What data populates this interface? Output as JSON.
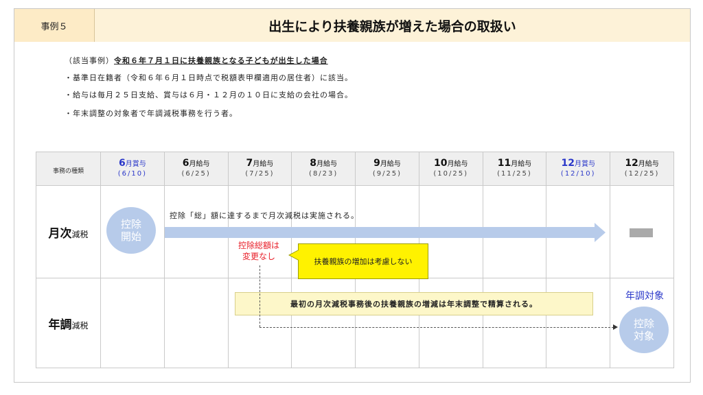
{
  "header": {
    "case_label": "事例５",
    "title": "出生により扶養親族が増えた場合の取扱い"
  },
  "description": {
    "applicable_prefix": "（該当事例）",
    "applicable_case": "令和６年７月１日に扶養親族となる子どもが出生した場合",
    "lines": [
      "・基準日在籍者（令和６年６月１日時点で税額表甲欄適用の居住者）に該当。",
      "・給与は毎月２５日支給、賞与は６月・１２月の１０日に支給の会社の場合。",
      "・年末調整の対象者で年調減税事務を行う者。"
    ]
  },
  "table": {
    "kind_header": "事務の種類",
    "months": [
      {
        "num": "6",
        "type": "月賞与",
        "date": "(6/10)",
        "accent": "#2a37c9"
      },
      {
        "num": "6",
        "type": "月給与",
        "date": "(6/25)",
        "accent": "#111111"
      },
      {
        "num": "7",
        "type": "月給与",
        "date": "(7/25)",
        "accent": "#111111"
      },
      {
        "num": "8",
        "type": "月給与",
        "date": "(8/23)",
        "accent": "#111111"
      },
      {
        "num": "9",
        "type": "月給与",
        "date": "(9/25)",
        "accent": "#111111"
      },
      {
        "num": "10",
        "type": "月給与",
        "date": "(10/25)",
        "accent": "#111111"
      },
      {
        "num": "11",
        "type": "月給与",
        "date": "(11/25)",
        "accent": "#111111"
      },
      {
        "num": "12",
        "type": "月賞与",
        "date": "(12/10)",
        "accent": "#2a37c9"
      },
      {
        "num": "12",
        "type": "月給与",
        "date": "(12/25)",
        "accent": "#111111"
      }
    ],
    "rows": {
      "monthly": {
        "bold": "月次",
        "rest": "減税"
      },
      "yearend": {
        "bold": "年調",
        "rest": "減税"
      }
    }
  },
  "annotations": {
    "deduction_start_1": "控除",
    "deduction_start_2": "開始",
    "arrow_text": "控除「総」額に達するまで月次減税は実施される。",
    "red_note_1": "控除総額は",
    "red_note_2": "変更なし",
    "yellow_note": "扶養親族の増加は考慮しない",
    "settle_note": "最初の月次減税事務後の扶養親族の増減は年末調整で精算される。",
    "yearend_target_label": "年調対象",
    "deduction_target_1": "控除",
    "deduction_target_2": "対象"
  },
  "colors": {
    "header_bg": "#fdf2d8",
    "circle": "#b7cbea",
    "accent_blue": "#2a37c9",
    "note_red": "#e8202a",
    "note_yellow": "#fff200"
  }
}
